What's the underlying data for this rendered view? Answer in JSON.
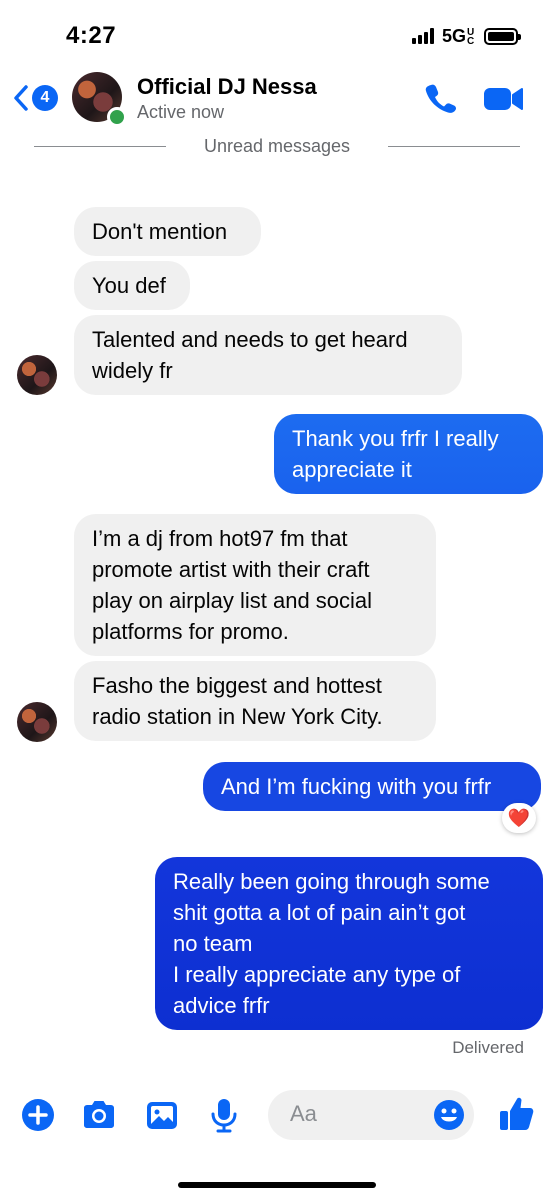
{
  "status_bar": {
    "time": "4:27",
    "network": "5G",
    "network_sub": "UC"
  },
  "header": {
    "unread_badge": "4",
    "contact_name": "Official DJ Nessa",
    "presence": "Active now",
    "icons": [
      "back-chevron-icon",
      "phone-icon",
      "video-camera-icon"
    ]
  },
  "divider": {
    "label": "Unread messages"
  },
  "messages": [
    {
      "dir": "in",
      "text": "Don't mention"
    },
    {
      "dir": "in",
      "text": "You def"
    },
    {
      "dir": "in",
      "lines": [
        "Talented and needs to get heard",
        "widely fr"
      ]
    },
    {
      "dir": "out",
      "lines": [
        "Thank you frfr I really",
        "appreciate it"
      ]
    },
    {
      "dir": "in",
      "lines": [
        "I’m a dj from hot97 fm that",
        "promote  artist with their craft",
        "play on airplay list and social",
        "platforms for promo."
      ]
    },
    {
      "dir": "in",
      "lines": [
        "Fasho the biggest and hottest",
        "radio station in New York City."
      ]
    },
    {
      "dir": "out",
      "text": "And I’m fucking with you frfr",
      "reaction": "❤️"
    },
    {
      "dir": "out",
      "lines": [
        "Really been going through some",
        "shit gotta a lot of pain ain’t got",
        "no team",
        "I really appreciate any type of",
        "advice frfr"
      ]
    }
  ],
  "receipt": "Delivered",
  "composer": {
    "placeholder": "Aa",
    "tools": [
      "plus-icon",
      "camera-icon",
      "photo-icon",
      "microphone-icon"
    ],
    "trailing": [
      "emoji-icon",
      "thumbs-up-icon"
    ]
  },
  "colors": {
    "accent": "#0a66f5",
    "incoming_bubble": "#f0f0f0",
    "outgoing_top": "#1d6cf0",
    "outgoing_bottom": "#0e35d4"
  }
}
